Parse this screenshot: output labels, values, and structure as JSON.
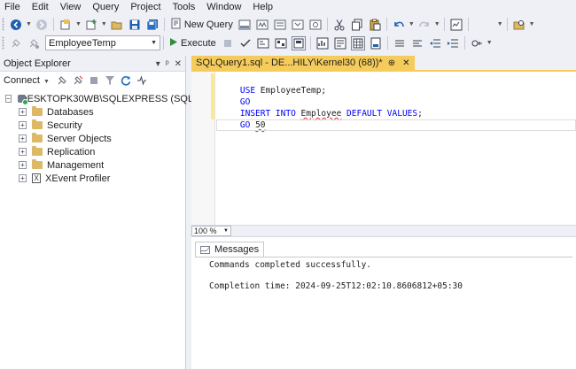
{
  "menu": [
    "File",
    "Edit",
    "View",
    "Query",
    "Project",
    "Tools",
    "Window",
    "Help"
  ],
  "toolbar": {
    "new_query_label": "New Query",
    "database_selected": "EmployeeTemp",
    "execute_label": "Execute"
  },
  "object_explorer": {
    "title": "Object Explorer",
    "title_buttons": [
      "▾",
      "ᵖ",
      "✕"
    ],
    "connect_label": "Connect",
    "server_node": "DESKTOPK30WB\\SQLEXPRESS (SQL Serv",
    "children": [
      "Databases",
      "Security",
      "Server Objects",
      "Replication",
      "Management",
      "XEvent Profiler"
    ]
  },
  "editor": {
    "tab_title": "SQLQuery1.sql - DE...HILY\\Kernel30 (68))*",
    "tab_pin": "⊕",
    "tab_close": "✕",
    "lines": [
      {
        "kw": "USE",
        "rest": " EmployeeTemp;"
      },
      {
        "kw": "GO",
        "rest": ""
      },
      {
        "kw": "INSERT INTO",
        "sq": "Employee",
        "kw2": "DEFAULT VALUES",
        "rest": ";"
      },
      {
        "kw": "GO",
        "num": "50"
      }
    ],
    "zoom": "100 %"
  },
  "results": {
    "tab_label": "Messages",
    "messages": [
      "Commands completed successfully.",
      "Completion time: 2024-09-25T12:02:10.8606812+05:30"
    ]
  },
  "colors": {
    "tab_active": "#f5cc5c",
    "keyword": "#0000ff",
    "squiggle": "#d13438"
  }
}
